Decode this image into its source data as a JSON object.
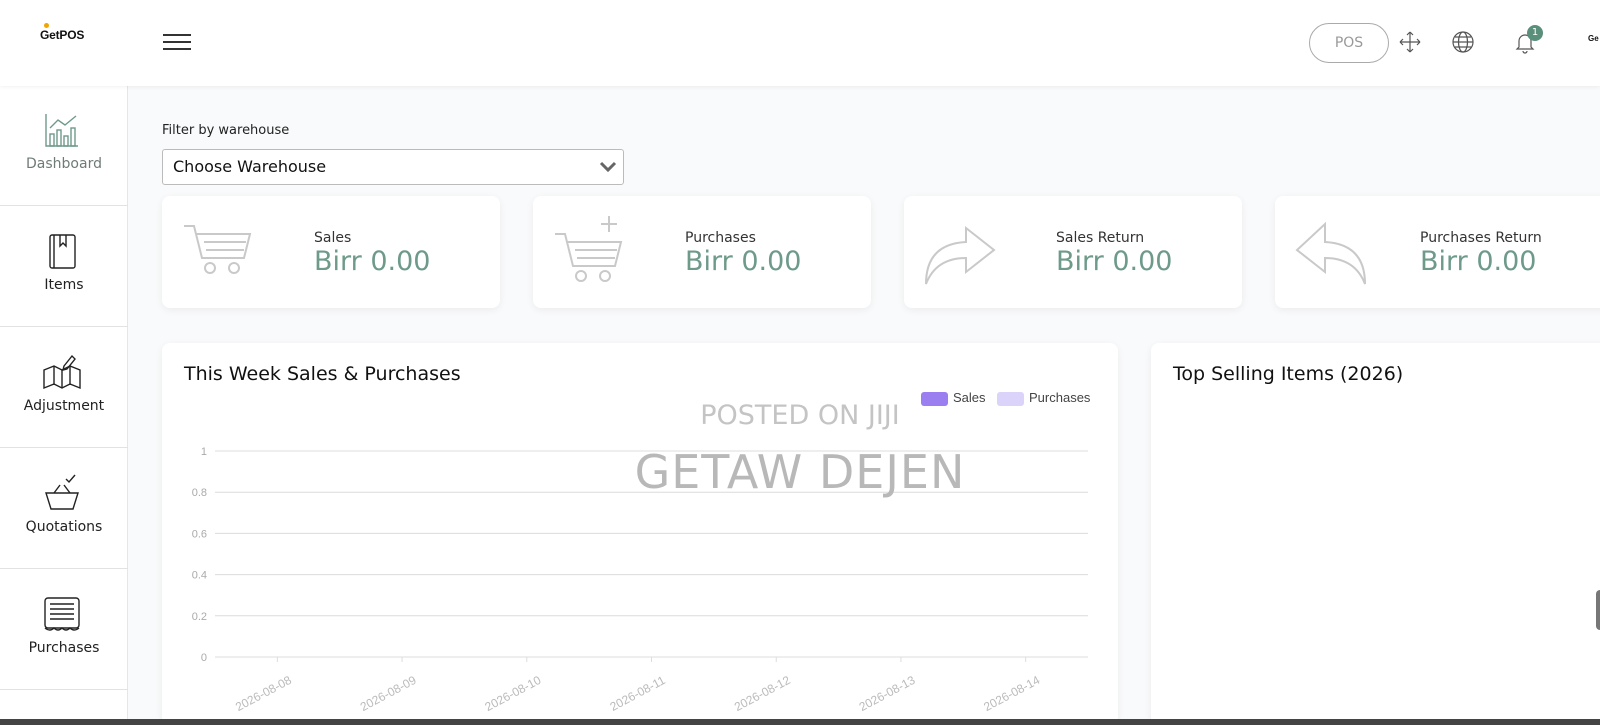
{
  "header": {
    "logo": "GetPOS",
    "pos_label": "POS",
    "notification_count": "1",
    "avatar_text": "Ge",
    "icons": [
      "menu-icon",
      "fullscreen-icon",
      "globe-icon",
      "bell-icon"
    ]
  },
  "sidebar": {
    "items": [
      {
        "label": "Dashboard",
        "icon": "chart-icon"
      },
      {
        "label": "Items",
        "icon": "book-icon"
      },
      {
        "label": "Adjustment",
        "icon": "map-edit-icon"
      },
      {
        "label": "Quotations",
        "icon": "basket-check-icon"
      },
      {
        "label": "Purchases",
        "icon": "receipt-icon"
      }
    ]
  },
  "filter": {
    "label": "Filter by warehouse",
    "selected": "Choose Warehouse"
  },
  "stats": [
    {
      "title": "Sales",
      "value": "Birr 0.00",
      "icon": "cart-icon"
    },
    {
      "title": "Purchases",
      "value": "Birr 0.00",
      "icon": "cart-plus-icon"
    },
    {
      "title": "Sales Return",
      "value": "Birr 0.00",
      "icon": "forward-arrow-icon"
    },
    {
      "title": "Purchases Return",
      "value": "Birr 0.00",
      "icon": "reply-arrow-icon"
    }
  ],
  "weekly_panel": {
    "title": "This Week Sales & Purchases"
  },
  "top_panel": {
    "title": "Top Selling Items (2026)"
  },
  "watermark": {
    "line1": "POSTED ON JIJI",
    "line2": "GETAW DEJEN"
  },
  "colors": {
    "accent": "#6e9a8a",
    "sales": "#9b7ff0",
    "purchases": "#dcd3fb",
    "badge": "#5a8f7b"
  },
  "chart_data": {
    "type": "bar",
    "title": "This Week Sales & Purchases",
    "categories": [
      "2026-08-08",
      "2026-08-09",
      "2026-08-10",
      "2026-08-11",
      "2026-08-12",
      "2026-08-13",
      "2026-08-14"
    ],
    "series": [
      {
        "name": "Sales",
        "values": [
          0,
          0,
          0,
          0,
          0,
          0,
          0
        ]
      },
      {
        "name": "Purchases",
        "values": [
          0,
          0,
          0,
          0,
          0,
          0,
          0
        ]
      }
    ],
    "yticks": [
      "1",
      "0.8",
      "0.6",
      "0.4",
      "0.2",
      "0"
    ],
    "ylim": [
      0,
      1
    ],
    "grid": true,
    "legend": "top-right"
  }
}
